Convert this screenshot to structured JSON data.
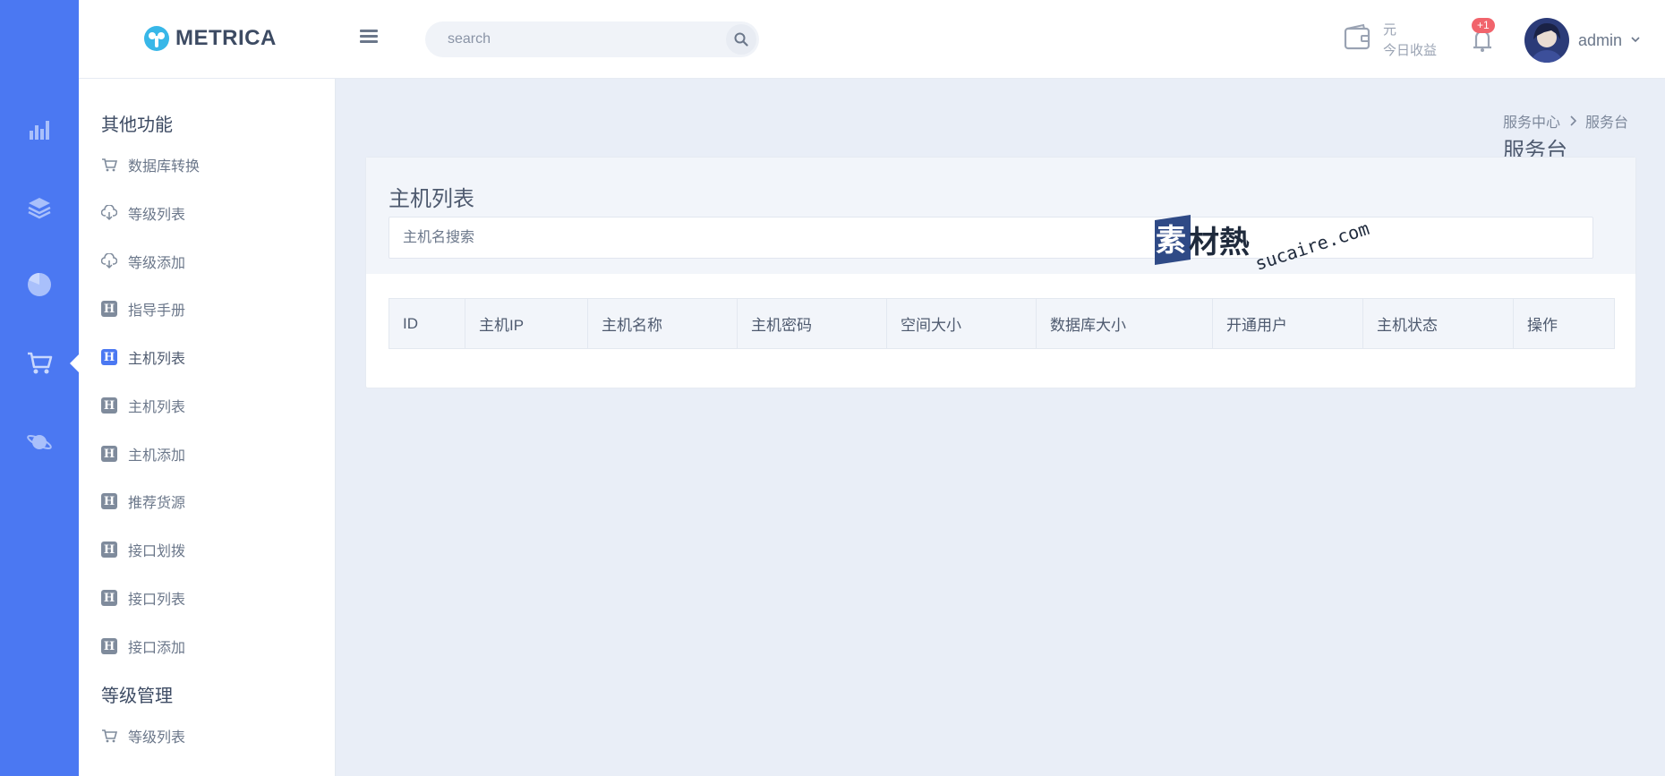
{
  "brand": {
    "name": "METRICA",
    "accent": "#4b78f2"
  },
  "header": {
    "search_placeholder": "search",
    "earnings_unit": "元",
    "earnings_label": "今日收益",
    "notification_badge": "+1",
    "user_name": "admin"
  },
  "rail": {
    "icons": [
      "bar-chart-icon",
      "layers-icon",
      "pie-chart-icon",
      "shopping-cart-icon",
      "planet-icon"
    ],
    "active": "shopping-cart-icon"
  },
  "sidebar": {
    "sections": [
      {
        "title": "其他功能",
        "items": [
          {
            "label": "数据库转换",
            "icon": "cart-icon"
          },
          {
            "label": "等级列表",
            "icon": "cloud-download-icon"
          },
          {
            "label": "等级添加",
            "icon": "cloud-download-icon"
          },
          {
            "label": "指导手册",
            "icon": "h-icon"
          },
          {
            "label": "主机列表",
            "icon": "h-icon",
            "active": true
          },
          {
            "label": "主机列表",
            "icon": "h-icon"
          },
          {
            "label": "主机添加",
            "icon": "h-icon"
          },
          {
            "label": "推荐货源",
            "icon": "h-icon"
          },
          {
            "label": "接口划拨",
            "icon": "h-icon"
          },
          {
            "label": "接口列表",
            "icon": "h-icon"
          },
          {
            "label": "接口添加",
            "icon": "h-icon"
          }
        ]
      },
      {
        "title": "等级管理",
        "items": [
          {
            "label": "等级列表",
            "icon": "cart-icon"
          }
        ]
      }
    ]
  },
  "breadcrumb": {
    "parent": "服务中心",
    "current": "服务台"
  },
  "page_title": "服务台",
  "card": {
    "title": "主机列表",
    "search_placeholder": "主机名搜索",
    "columns": [
      "ID",
      "主机IP",
      "主机名称",
      "主机密码",
      "空间大小",
      "数据库大小",
      "开通用户",
      "主机状态",
      "操作"
    ]
  },
  "watermark": {
    "cn": "素材熱",
    "en": "sucaire.com"
  }
}
